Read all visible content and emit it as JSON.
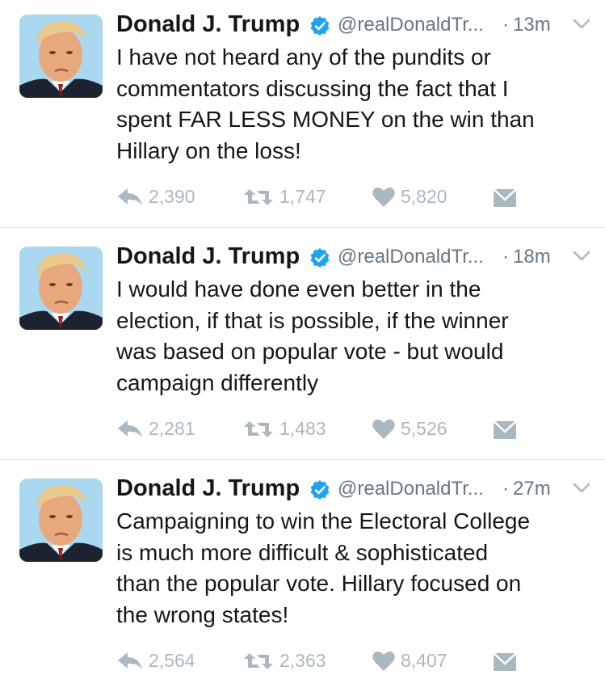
{
  "colors": {
    "text": "#14171a",
    "secondary": "#657786",
    "action_icon": "#aab8c2",
    "verified_badge": "#1da1f2",
    "divider": "#e1e8ed"
  },
  "tweets": [
    {
      "author_name": "Donald J. Trump",
      "verified": true,
      "handle": "@realDonaldTr...",
      "separator": "·",
      "time": "13m",
      "lines": [
        "I have not heard any of the pundits or",
        "commentators discussing the fact that I",
        "spent FAR LESS MONEY on the win than",
        "Hillary on the loss!"
      ],
      "replies": "2,390",
      "retweets": "1,747",
      "likes": "5,820"
    },
    {
      "author_name": "Donald J. Trump",
      "verified": true,
      "handle": "@realDonaldTr...",
      "separator": "·",
      "time": "18m",
      "lines": [
        "I would have done even better in the",
        "election, if that is possible, if the winner",
        "was based on popular vote - but would",
        "campaign differently"
      ],
      "replies": "2,281",
      "retweets": "1,483",
      "likes": "5,526"
    },
    {
      "author_name": "Donald J. Trump",
      "verified": true,
      "handle": "@realDonaldTr...",
      "separator": "·",
      "time": "27m",
      "lines": [
        "Campaigning to win the Electoral College",
        "is much more difficult & sophisticated",
        "than the popular vote. Hillary focused on",
        "the wrong states!"
      ],
      "replies": "2,564",
      "retweets": "2,363",
      "likes": "8,407"
    }
  ]
}
